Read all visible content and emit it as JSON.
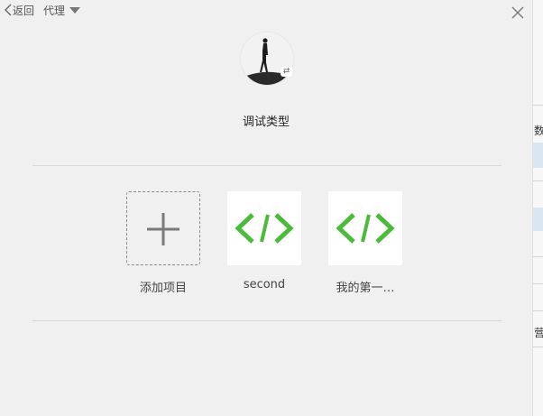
{
  "topbar": {
    "back_label": "返回",
    "proxy_label": "代理"
  },
  "profile": {
    "switch_glyph": "⇄",
    "type_label": "调试类型"
  },
  "projects": {
    "add_label": "添加项目",
    "items": [
      {
        "label": "second",
        "icon": "code-icon"
      },
      {
        "label": "我的第一…",
        "icon": "code-icon"
      }
    ]
  },
  "background_sliver": {
    "text_1": "数",
    "text_2": "营"
  },
  "colors": {
    "accent_green": "#4cbb3c",
    "background": "#f0f0f0"
  }
}
